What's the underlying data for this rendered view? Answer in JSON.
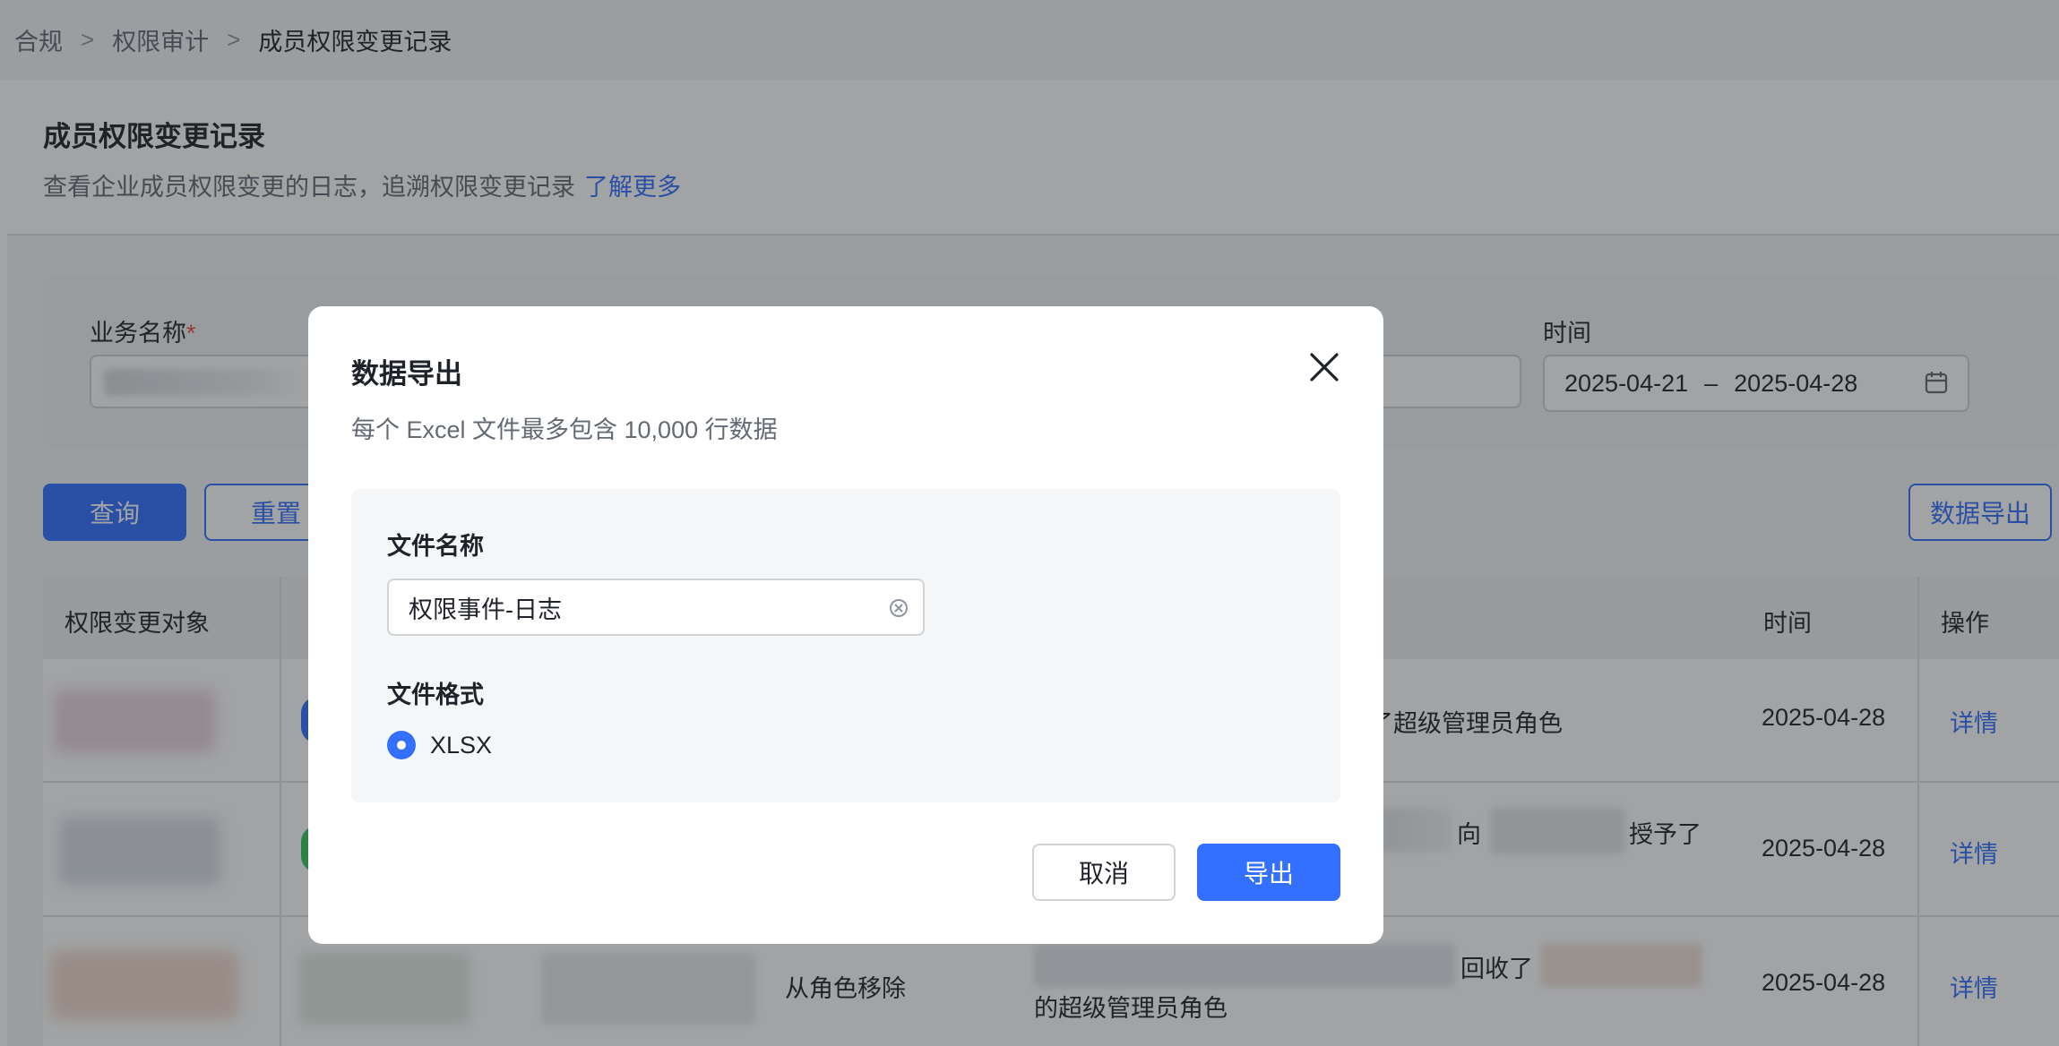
{
  "breadcrumb": {
    "items": [
      "合规",
      "权限审计",
      "成员权限变更记录"
    ],
    "separator": ">"
  },
  "header": {
    "title": "成员权限变更记录",
    "description": "查看企业成员权限变更的日志，追溯权限变更记录",
    "learn_more": "了解更多"
  },
  "filters": {
    "business_name_label": "业务名称",
    "required_mark": "*",
    "time_label": "时间",
    "date_start": "2025-04-21",
    "date_separator": "–",
    "date_end": "2025-04-28"
  },
  "actions": {
    "query": "查询",
    "reset": "重置",
    "export": "数据导出"
  },
  "table": {
    "headers": {
      "target": "权限变更对象",
      "time": "时间",
      "operation": "操作"
    },
    "rows": [
      {
        "desc_tail": "了超级管理员角色",
        "time": "2025-04-28",
        "action": "详情"
      },
      {
        "desc_mid": "向",
        "desc_tail": "授予了",
        "time": "2025-04-28",
        "action": "详情"
      },
      {
        "desc_col": "从角色移除",
        "desc_mid": "回收了",
        "desc_line2": "的超级管理员角色",
        "time": "2025-04-28",
        "action": "详情"
      }
    ]
  },
  "modal": {
    "title": "数据导出",
    "subtitle": "每个 Excel 文件最多包含 10,000 行数据",
    "file_name_label": "文件名称",
    "file_name_value": "权限事件-日志",
    "file_format_label": "文件格式",
    "format_option": "XLSX",
    "cancel": "取消",
    "confirm": "导出"
  },
  "colors": {
    "primary": "#3370ff",
    "required": "#f54a45",
    "overlay": "rgba(31,35,41,0.42)"
  }
}
